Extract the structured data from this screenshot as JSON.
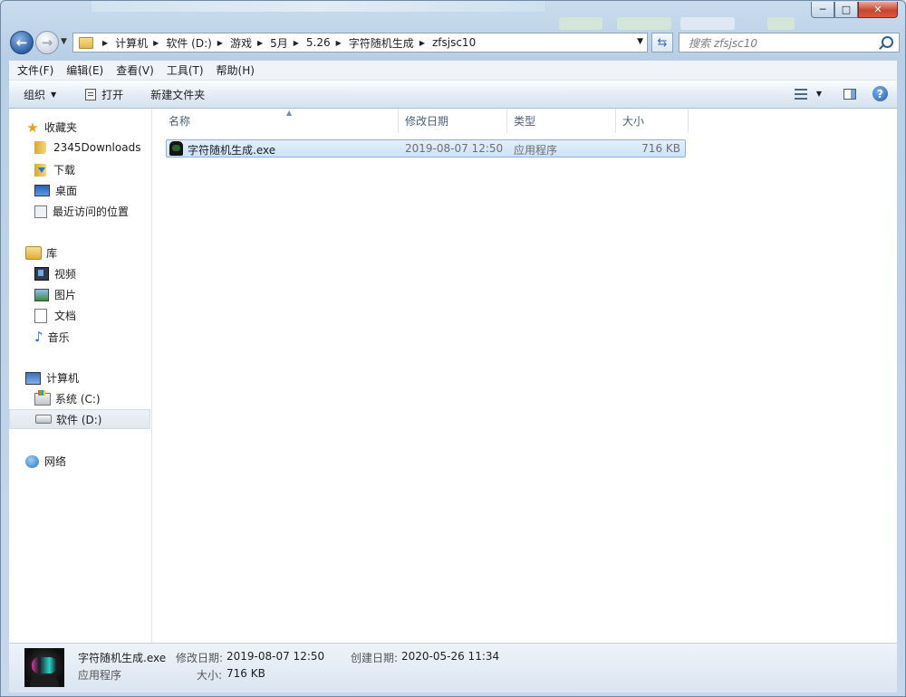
{
  "window": {
    "buttons": {
      "minimize": "─",
      "maximize": "□",
      "close": "✕"
    }
  },
  "address": {
    "crumbs": [
      "计算机",
      "软件 (D:)",
      "游戏",
      "5月",
      "5.26",
      "字符随机生成",
      "zfsjsc10"
    ]
  },
  "search": {
    "placeholder": "搜索 zfsjsc10"
  },
  "menu": {
    "items": [
      "文件(F)",
      "编辑(E)",
      "查看(V)",
      "工具(T)",
      "帮助(H)"
    ]
  },
  "toolbar": {
    "organize": "组织",
    "open": "打开",
    "new_folder": "新建文件夹"
  },
  "sidebar": {
    "favorites": "收藏夹",
    "fav_items": [
      "2345Downloads",
      "下载",
      "桌面",
      "最近访问的位置"
    ],
    "libraries": "库",
    "lib_items": [
      "视频",
      "图片",
      "文档",
      "音乐"
    ],
    "computer": "计算机",
    "comp_items": [
      "系统 (C:)",
      "软件 (D:)"
    ],
    "network": "网络"
  },
  "columns": {
    "name": "名称",
    "date": "修改日期",
    "type": "类型",
    "size": "大小"
  },
  "files": [
    {
      "name": "字符随机生成.exe",
      "date": "2019-08-07 12:50",
      "type": "应用程序",
      "size": "716 KB"
    }
  ],
  "details": {
    "name": "字符随机生成.exe",
    "type": "应用程序",
    "modified_label": "修改日期:",
    "modified": "2019-08-07 12:50",
    "created_label": "创建日期:",
    "created": "2020-05-26 11:34",
    "size_label": "大小:",
    "size": "716 KB"
  }
}
